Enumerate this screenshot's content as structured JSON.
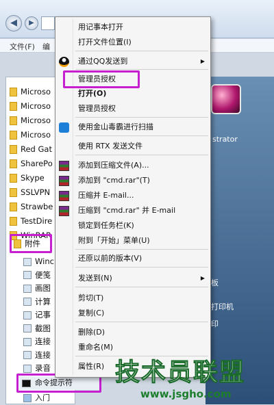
{
  "explorer": {
    "menu_file": "文件(F)",
    "menu_edit": "编",
    "left_items": [
      "Microso",
      "Microso",
      "Microso",
      "Microso",
      "Red Gat",
      "SharePo",
      "Skype",
      "SSLVPN",
      "Strawbe",
      "TestDire",
      "WinRAR"
    ],
    "accessories": "附件",
    "sub_items": [
      "Winc",
      "便笺",
      "画图",
      "计算",
      "记事",
      "截图",
      "连接",
      "连接",
      "录音"
    ],
    "cmd": "命令提示符",
    "intro": "入门",
    "right_items": [
      "strator",
      "板",
      "打印机",
      "印"
    ]
  },
  "context_menu": {
    "items": [
      {
        "label": "用记事本打开",
        "icon": ""
      },
      {
        "label": "打开文件位置(I)",
        "icon": ""
      },
      {
        "label": "通过QQ发送到",
        "icon": "qq-penguin-icon",
        "submenu": true
      },
      {
        "label": "管理员授权",
        "icon": ""
      },
      {
        "label": "打开(O)",
        "icon": "",
        "bold": true
      },
      {
        "label": "管理员授权",
        "icon": ""
      },
      {
        "label": "使用金山毒霸进行扫描",
        "icon": "antivirus-icon"
      },
      {
        "label": "使用 RTX 发送文件",
        "icon": ""
      },
      {
        "label": "添加到压缩文件(A)...",
        "icon": "winrar-icon"
      },
      {
        "label": "添加到 \"cmd.rar\"(T)",
        "icon": "winrar-icon"
      },
      {
        "label": "压缩并 E-mail...",
        "icon": "winrar-icon"
      },
      {
        "label": "压缩到 \"cmd.rar\" 并 E-mail",
        "icon": "winrar-icon"
      },
      {
        "label": "锁定到任务栏(K)",
        "icon": ""
      },
      {
        "label": "附到「开始」菜单(U)",
        "icon": ""
      },
      {
        "label": "还原以前的版本(V)",
        "icon": ""
      },
      {
        "label": "发送到(N)",
        "icon": "",
        "submenu": true
      },
      {
        "label": "剪切(T)",
        "icon": ""
      },
      {
        "label": "复制(C)",
        "icon": ""
      },
      {
        "label": "删除(D)",
        "icon": ""
      },
      {
        "label": "重命名(M)",
        "icon": ""
      },
      {
        "label": "属性(R)",
        "icon": ""
      }
    ]
  },
  "watermark": {
    "title": "技术员联盟",
    "url": "www.jsgho.com"
  },
  "colors": {
    "highlight": "#c51fd0",
    "watermark_green": "#17a83b"
  }
}
